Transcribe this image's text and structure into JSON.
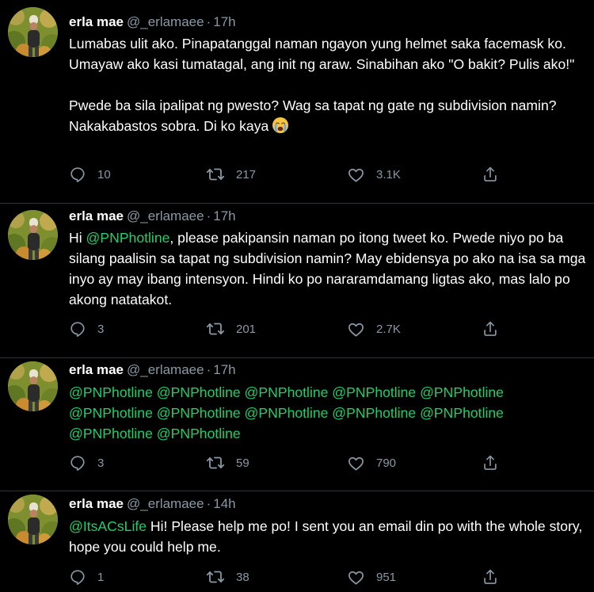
{
  "tweets": [
    {
      "author": {
        "name": "erla mae",
        "handle": "@_erlamaee"
      },
      "separator": "·",
      "time": "17h",
      "text": {
        "p1": "Lumabas ulit ako. Pinapatanggal naman ngayon yung helmet saka facemask ko. Umayaw ako kasi tumatagal, ang init ng araw. Sinabihan ako \"O bakit? Pulis ako!\"",
        "p2": "Pwede ba sila ipalipat ng pwesto? Wag sa tapat ng gate ng subdivision namin? Nakakabastos sobra. Di ko kaya",
        "emoji": "loudly-crying-face"
      },
      "stats": {
        "replies": "10",
        "retweets": "217",
        "likes": "3.1K"
      }
    },
    {
      "author": {
        "name": "erla mae",
        "handle": "@_erlamaee"
      },
      "separator": "·",
      "time": "17h",
      "text": {
        "greeting": "Hi ",
        "mention": "@PNPhotline",
        "rest": ", please pakipansin naman po itong tweet ko. Pwede niyo po ba silang paalisin sa tapat ng subdivision namin? May ebidensya po ako na isa sa mga inyo ay may ibang intensyon. Hindi ko po nararamdamang ligtas ako, mas lalo po akong natatakot."
      },
      "stats": {
        "replies": "3",
        "retweets": "201",
        "likes": "2.7K"
      }
    },
    {
      "author": {
        "name": "erla mae",
        "handle": "@_erlamaee"
      },
      "separator": "·",
      "time": "17h",
      "text": {
        "mentions": "@PNPhotline @PNPhotline @PNPhotline @PNPhotline @PNPhotline @PNPhotline @PNPhotline @PNPhotline @PNPhotline @PNPhotline @PNPhotline @PNPhotline"
      },
      "stats": {
        "replies": "3",
        "retweets": "59",
        "likes": "790"
      }
    },
    {
      "author": {
        "name": "erla mae",
        "handle": "@_erlamaee"
      },
      "separator": "·",
      "time": "14h",
      "text": {
        "mention": "@ItsACsLife",
        "rest": " Hi! Please help me po! I sent you an email din po with the whole story, hope you could help me."
      },
      "stats": {
        "replies": "1",
        "retweets": "38",
        "likes": "951"
      }
    }
  ],
  "icons": {
    "reply": "reply-icon",
    "retweet": "retweet-icon",
    "like": "heart-icon",
    "share": "share-icon"
  },
  "colors": {
    "background": "#000000",
    "text": "#ffffff",
    "muted": "#8899a6",
    "mention": "#1fcf6a"
  }
}
